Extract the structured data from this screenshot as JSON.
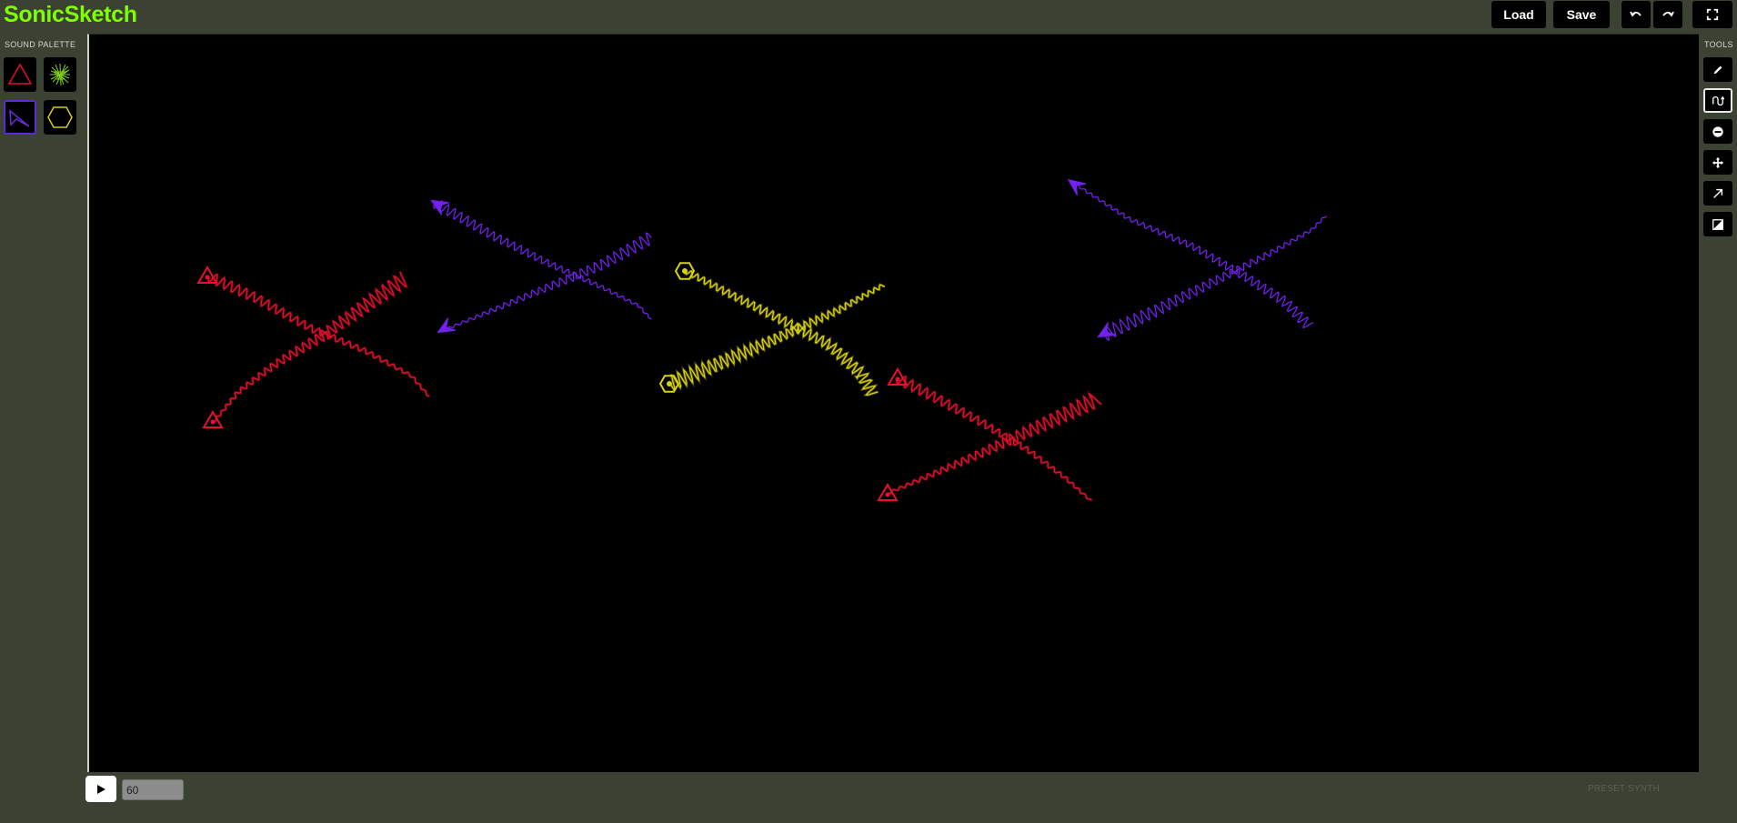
{
  "app": {
    "title": "SonicSketch"
  },
  "toolbar": {
    "load_label": "Load",
    "save_label": "Save",
    "undo_icon": "undo-icon",
    "redo_icon": "redo-icon",
    "fullscreen_icon": "fullscreen-icon"
  },
  "palette": {
    "label": "SOUND PALETTE",
    "items": [
      {
        "name": "triangle",
        "color": "#e0112b",
        "selected": false
      },
      {
        "name": "noise",
        "color": "#7fd11b",
        "selected": false
      },
      {
        "name": "arrowhead",
        "color": "#6b2bd9",
        "selected": true
      },
      {
        "name": "hexagon",
        "color": "#d8cc12",
        "selected": false
      }
    ]
  },
  "tools": {
    "label": "TOOLS",
    "items": [
      {
        "name": "pencil",
        "icon": "pencil-icon",
        "selected": false
      },
      {
        "name": "pitch",
        "icon": "pitch-curve-icon",
        "selected": true
      },
      {
        "name": "erase",
        "icon": "erase-icon",
        "selected": false
      },
      {
        "name": "move",
        "icon": "move-icon",
        "selected": false
      },
      {
        "name": "link",
        "icon": "arrow-icon",
        "selected": false
      },
      {
        "name": "contrast",
        "icon": "contrast-icon",
        "selected": false
      }
    ]
  },
  "transport": {
    "play_icon": "play-icon",
    "tempo_value": "60",
    "preset_label": "PRESET SYNTH"
  },
  "colors": {
    "red": "#e8102a",
    "purple": "#7320f0",
    "yellow": "#d9d20f",
    "background": "#3b4133",
    "accent": "#7fff00"
  }
}
